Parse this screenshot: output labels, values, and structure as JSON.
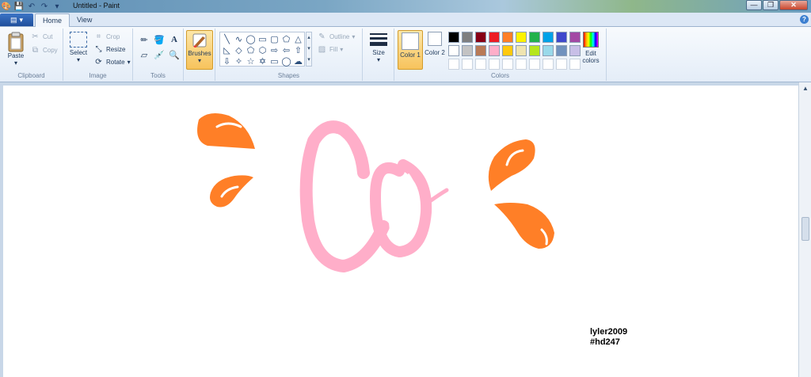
{
  "window": {
    "title": "Untitled - Paint",
    "buttons": {
      "minimize": "—",
      "maximize": "❐",
      "close": "✕"
    }
  },
  "quick_access": [
    "save-icon",
    "undo-icon",
    "redo-icon",
    "customize-icon"
  ],
  "tabs": [
    {
      "label": "Home",
      "active": true
    },
    {
      "label": "View",
      "active": false
    }
  ],
  "ribbon": {
    "clipboard": {
      "label": "Clipboard",
      "paste": "Paste",
      "cut": "Cut",
      "copy": "Copy"
    },
    "image": {
      "label": "Image",
      "select": "Select",
      "crop": "Crop",
      "resize": "Resize",
      "rotate": "Rotate"
    },
    "tools": {
      "label": "Tools"
    },
    "brushes": {
      "label": "Brushes"
    },
    "shapes": {
      "label": "Shapes",
      "outline": "Outline",
      "fill": "Fill"
    },
    "size": {
      "label": "Size"
    },
    "colors": {
      "label": "Colors",
      "color1": "Color 1",
      "color2": "Color 2",
      "edit": "Edit colors",
      "color1_value": "#ffffff",
      "color2_value": "#ffffff",
      "palette_row1": [
        "#000000",
        "#7f7f7f",
        "#880015",
        "#ed1c24",
        "#ff7f27",
        "#fff200",
        "#22b14c",
        "#00a2e8",
        "#3f48cc",
        "#a349a4"
      ],
      "palette_row2": [
        "#ffffff",
        "#c3c3c3",
        "#b97a57",
        "#ffaec9",
        "#ffc90e",
        "#efe4b0",
        "#b5e61d",
        "#99d9ea",
        "#7092be",
        "#c8bfe7"
      ],
      "palette_row3": [
        "#ffffff",
        "#ffffff",
        "#ffffff",
        "#ffffff",
        "#ffffff",
        "#ffffff",
        "#ffffff",
        "#ffffff",
        "#ffffff",
        "#ffffff"
      ]
    }
  },
  "canvas": {
    "signature_line1": "lyler2009",
    "signature_line2": "#hd247",
    "drawing": {
      "drop_color": "#ff7f27",
      "letters_color": "#ffaec9",
      "highlight_color": "#ffffff"
    }
  }
}
